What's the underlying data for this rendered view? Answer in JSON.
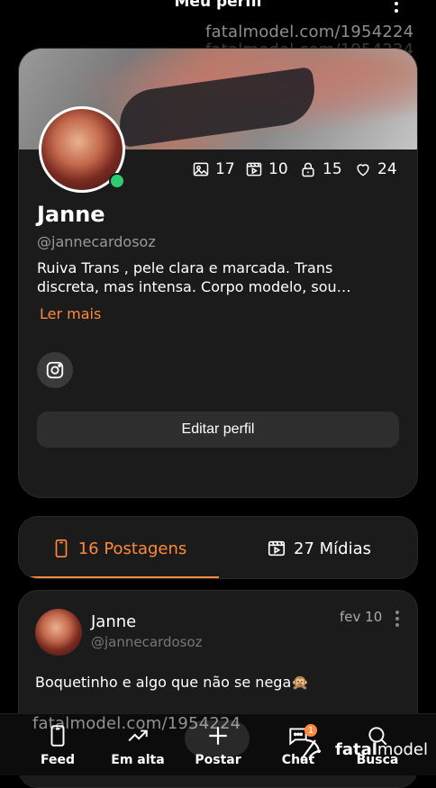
{
  "header": {
    "title": "Meu perfil"
  },
  "watermark": {
    "text": "fatalmodel.com/1954224"
  },
  "profile": {
    "name": "Janne",
    "handle": "@jannecardosoz",
    "bio": "Ruiva Trans , pele clara e marcada. Trans discreta, mas intensa. Corpo modelo, sou…",
    "read_more": "Ler mais",
    "edit_button": "Editar perfil",
    "stats": [
      {
        "icon": "image-icon",
        "value": "17"
      },
      {
        "icon": "video-icon",
        "value": "10"
      },
      {
        "icon": "lock-icon",
        "value": "15"
      },
      {
        "icon": "heart-icon",
        "value": "24"
      }
    ]
  },
  "tabs": [
    {
      "label": "16 Postagens",
      "active": true
    },
    {
      "label": "27 Mídias",
      "active": false
    }
  ],
  "post": {
    "name": "Janne",
    "handle": "@jannecardosoz",
    "date": "fev 10",
    "text": "Boquetinho e algo que não se nega🙊"
  },
  "nav": {
    "items": [
      {
        "label": "Feed"
      },
      {
        "label": "Em alta"
      },
      {
        "label": "Postar"
      },
      {
        "label": "Chat",
        "badge": "1"
      },
      {
        "label": "Busca"
      }
    ]
  },
  "logo": {
    "part1": "fatal",
    "part2": "model"
  },
  "colors": {
    "accent": "#ff8a3d",
    "online": "#2ecc71",
    "background": "#000000",
    "card": "#1b1b1b"
  }
}
